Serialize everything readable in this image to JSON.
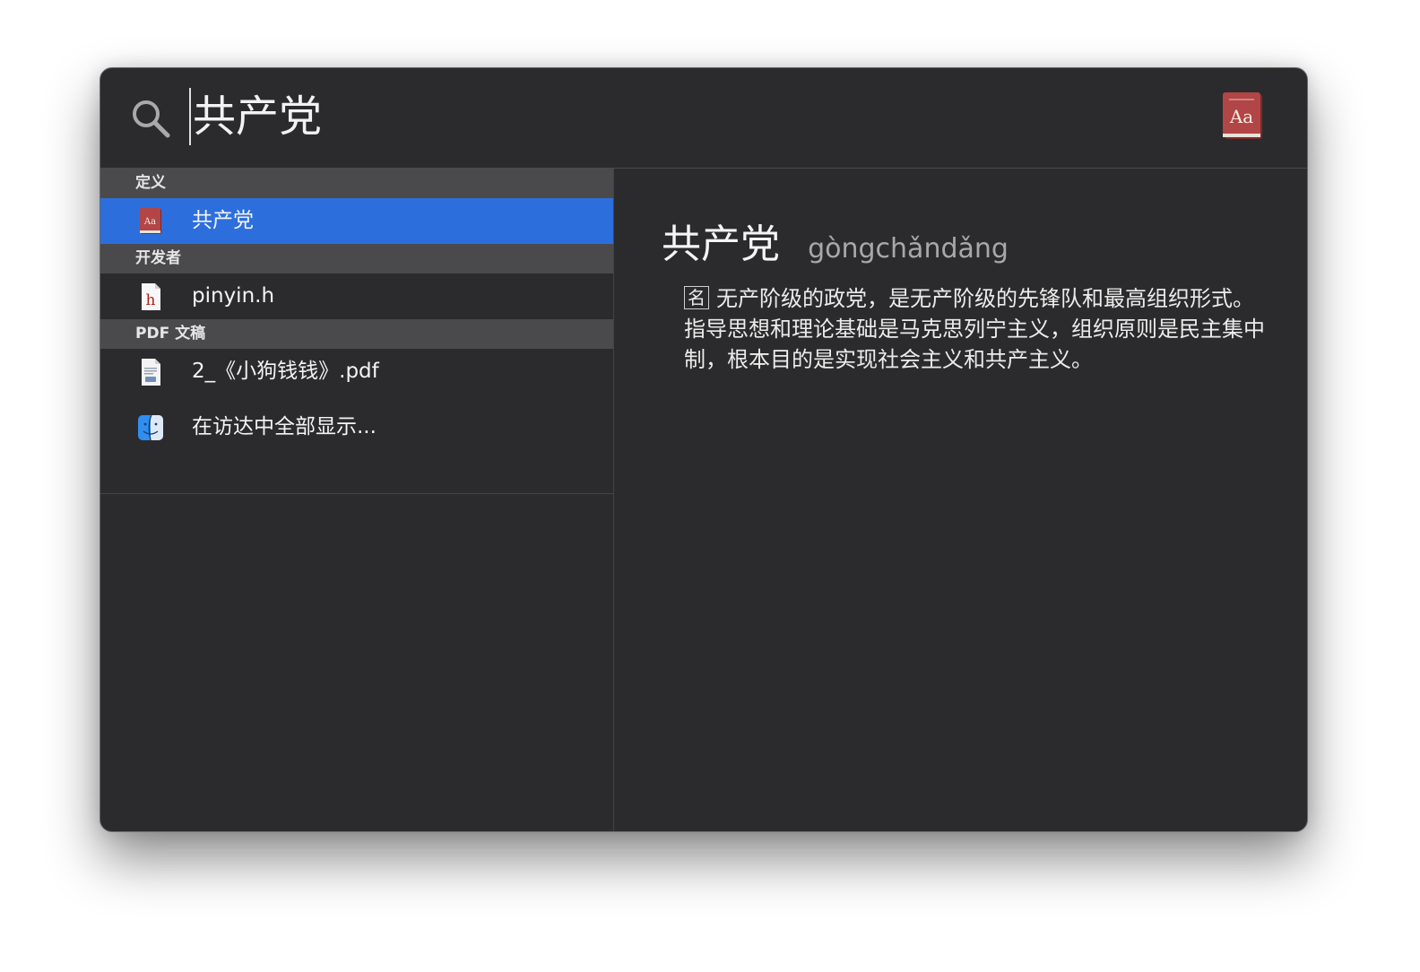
{
  "search": {
    "query": "共产党"
  },
  "app_icon": {
    "name": "dictionary-icon",
    "label": "Aa",
    "brand_color": "#a63c3c"
  },
  "results": {
    "sections": [
      {
        "header": "定义",
        "items": [
          {
            "label": "共产党",
            "icon": "dictionary-icon",
            "selected": true
          }
        ]
      },
      {
        "header": "开发者",
        "items": [
          {
            "label": "pinyin.h",
            "icon": "header-file-icon",
            "selected": false
          }
        ]
      },
      {
        "header": "PDF 文稿",
        "items": [
          {
            "label": "2_《小狗钱钱》.pdf",
            "icon": "pdf-document-icon",
            "selected": false
          }
        ]
      }
    ],
    "show_all_label": "在访达中全部显示...",
    "show_all_icon": "finder-icon"
  },
  "preview": {
    "word": "共产党",
    "pinyin": "gòngchǎndǎng",
    "part_of_speech": "名",
    "definition": "无产阶级的政党，是无产阶级的先锋队和最高组织形式。指导思想和理论基础是马克思列宁主义，组织原则是民主集中制，根本目的是实现社会主义和共产主义。"
  },
  "colors": {
    "window_bg": "#2b2b2d",
    "section_header_bg": "#4a4a4c",
    "selection": "#2c6fdc"
  }
}
